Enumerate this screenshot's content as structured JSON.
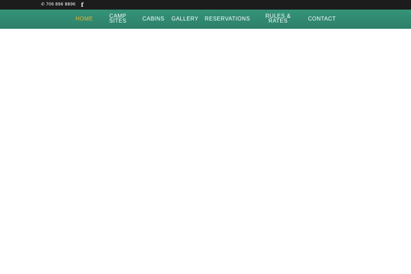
{
  "topbar": {
    "phone": "706 896 8896",
    "phone_icon": "phone-icon",
    "social_icon": "facebook-icon",
    "facebook_glyph": "f"
  },
  "nav": {
    "items": [
      {
        "label": "HOME",
        "active": true
      },
      {
        "label": "CAMP\nSITES",
        "active": false
      },
      {
        "label": "CABINS",
        "active": false
      },
      {
        "label": "GALLERY",
        "active": false
      },
      {
        "label": "RESERVATIONS",
        "active": false
      },
      {
        "label": "RULES &\nRATES",
        "active": false
      },
      {
        "label": "CONTACT",
        "active": false
      }
    ]
  },
  "colors": {
    "topbar_bg": "#1c1c1c",
    "nav_bg": "#318a72",
    "nav_text": "#ffffff",
    "nav_active": "#e7b43a"
  }
}
